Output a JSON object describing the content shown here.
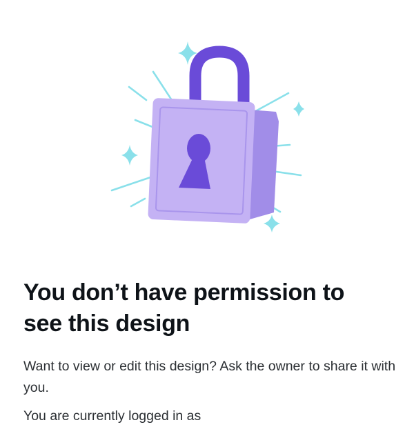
{
  "illustration": {
    "icon": "padlock-locked-illustration",
    "colors": {
      "shackle": "#6a4bd8",
      "body_front": "#c4b2f4",
      "body_side": "#a18de8",
      "keyhole": "#6a4bd8",
      "sparkle": "#8ae0ea"
    }
  },
  "heading": {
    "line1": "You don’t have permission to",
    "line2": "see this design"
  },
  "message": {
    "text": "Want to view or edit this design? Ask the owner to share it with you."
  },
  "account_status": {
    "text": "You are currently logged in as"
  }
}
